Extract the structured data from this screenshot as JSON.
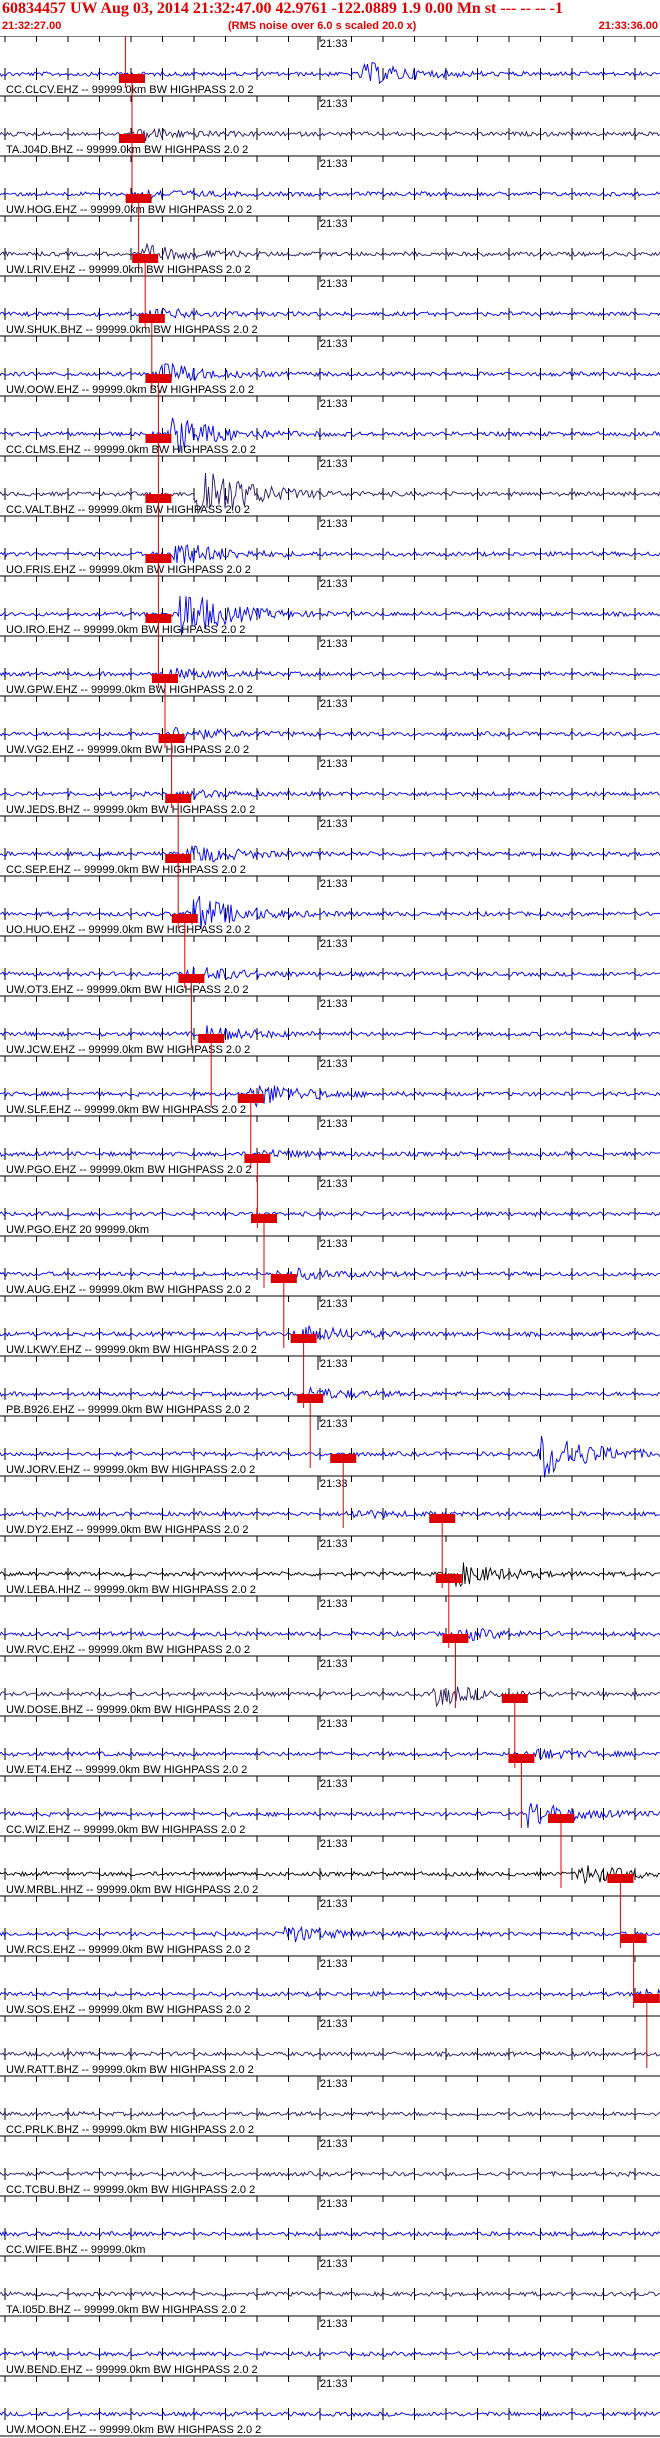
{
  "header": {
    "title": "60834457 UW Aug 03, 2014 21:32:47.00   42.9761 -122.0889  1.9 0.00 Mn st --- -- --  -1",
    "start_time": "21:32:27.00",
    "note": "(RMS noise over 6.0 s scaled 20.0 x)",
    "end_time": "21:33:36.00"
  },
  "minute_mark": "21:33",
  "colors": {
    "blue": "#0000ee",
    "purple": "#2a1a66",
    "black": "#000000",
    "pick": "#dd0000",
    "grid": "#000000"
  },
  "channels": [
    {
      "label": "CC.CLCV.EHZ -- 99999.0km BW  HIGHPASS  2.0  2",
      "color": "blue",
      "pick": 0.19,
      "burst": 0.55,
      "burst_amp": 3.0
    },
    {
      "label": "TA.J04D.BHZ -- 99999.0km BW  HIGHPASS  2.0  2",
      "color": "purple",
      "pick": 0.2,
      "burst": 0.21,
      "burst_amp": 1.6
    },
    {
      "label": "UW.HOG.EHZ -- 99999.0km BW  HIGHPASS  2.0  2",
      "color": "blue",
      "pick": 0.2,
      "burst": 0.21,
      "burst_amp": 1.3
    },
    {
      "label": "UW.LRIV.EHZ -- 99999.0km BW  HIGHPASS  2.0  2",
      "color": "purple",
      "pick": 0.21,
      "burst": 0.22,
      "burst_amp": 2.0
    },
    {
      "label": "UW.SHUK.BHZ -- 99999.0km BW  HIGHPASS  2.0  2",
      "color": "blue",
      "pick": 0.22,
      "burst": 0.23,
      "burst_amp": 1.4
    },
    {
      "label": "UW.OOW.EHZ -- 99999.0km BW  HIGHPASS  2.0  2",
      "color": "blue",
      "pick": 0.23,
      "burst": 0.24,
      "burst_amp": 3.0
    },
    {
      "label": "CC.CLMS.EHZ -- 99999.0km BW  HIGHPASS  2.0  2",
      "color": "blue",
      "pick": 0.24,
      "burst": 0.26,
      "burst_amp": 5.0
    },
    {
      "label": "CC.VALT.BHZ -- 99999.0km BW  HIGHPASS  2.0  2",
      "color": "purple",
      "pick": 0.24,
      "burst": 0.3,
      "burst_amp": 9.0
    },
    {
      "label": "UO.FRIS.EHZ -- 99999.0km BW  HIGHPASS  2.0  2",
      "color": "blue",
      "pick": 0.24,
      "burst": 0.26,
      "burst_amp": 3.5
    },
    {
      "label": "UO.IRO.EHZ -- 99999.0km BW  HIGHPASS  2.0  2",
      "color": "blue",
      "pick": 0.24,
      "burst": 0.27,
      "burst_amp": 7.0
    },
    {
      "label": "UW.GPW.EHZ -- 99999.0km BW  HIGHPASS  2.0  2",
      "color": "blue",
      "pick": 0.24,
      "burst": 0.25,
      "burst_amp": 1.4
    },
    {
      "label": "UW.VG2.EHZ -- 99999.0km BW  HIGHPASS  2.0  2",
      "color": "blue",
      "pick": 0.25,
      "burst": 0.26,
      "burst_amp": 1.8
    },
    {
      "label": "UW.JEDS.BHZ -- 99999.0km BW  HIGHPASS  2.0  2",
      "color": "blue",
      "pick": 0.26,
      "burst": 0.28,
      "burst_amp": 0.8
    },
    {
      "label": "CC.SEP.EHZ -- 99999.0km BW  HIGHPASS  2.0  2",
      "color": "blue",
      "pick": 0.27,
      "burst": 0.29,
      "burst_amp": 2.5
    },
    {
      "label": "UO.HUO.EHZ -- 99999.0km BW  HIGHPASS  2.0  2",
      "color": "blue",
      "pick": 0.27,
      "burst": 0.29,
      "burst_amp": 5.0
    },
    {
      "label": "UW.OT3.EHZ -- 99999.0km BW  HIGHPASS  2.0  2",
      "color": "blue",
      "pick": 0.28,
      "burst": 0.29,
      "burst_amp": 2.2
    },
    {
      "label": "UW.JCW.EHZ -- 99999.0km BW  HIGHPASS  2.0  2",
      "color": "blue",
      "pick": 0.29,
      "burst": 0.31,
      "burst_amp": 2.0
    },
    {
      "label": "UW.SLF.EHZ -- 99999.0km BW  HIGHPASS  2.0  2",
      "color": "blue",
      "pick": 0.32,
      "burst": 0.38,
      "burst_amp": 3.5
    },
    {
      "label": "UW.PGO.EHZ -- 99999.0km BW  HIGHPASS  2.0  2",
      "color": "blue",
      "pick": 0.38,
      "burst": 0.4,
      "burst_amp": 0.9
    },
    {
      "label": "UW.PGO.EHZ 20 99999.0km",
      "color": "blue",
      "pick": 0.39,
      "burst": 0.0,
      "burst_amp": 0.0
    },
    {
      "label": "UW.AUG.EHZ -- 99999.0km BW  HIGHPASS  2.0  2",
      "color": "blue",
      "pick": 0.4,
      "burst": 0.42,
      "burst_amp": 1.8
    },
    {
      "label": "UW.LKWY.EHZ -- 99999.0km BW  HIGHPASS  2.0  2",
      "color": "blue",
      "pick": 0.43,
      "burst": 0.45,
      "burst_amp": 2.4
    },
    {
      "label": "PB.B926.EHZ -- 99999.0km BW  HIGHPASS  2.0  2",
      "color": "blue",
      "pick": 0.46,
      "burst": 0.47,
      "burst_amp": 1.4
    },
    {
      "label": "UW.JORV.EHZ -- 99999.0km BW  HIGHPASS  2.0  2",
      "color": "blue",
      "pick": 0.47,
      "burst": 0.82,
      "burst_amp": 6.5
    },
    {
      "label": "UW.DY2.EHZ -- 99999.0km BW  HIGHPASS  2.0  2",
      "color": "blue",
      "pick": 0.52,
      "burst": 0.53,
      "burst_amp": 1.0
    },
    {
      "label": "UW.LEBA.HHZ -- 99999.0km BW  HIGHPASS  2.0  2",
      "color": "black",
      "pick": 0.67,
      "burst": 0.69,
      "burst_amp": 3.0
    },
    {
      "label": "UW.RVC.EHZ -- 99999.0km BW  HIGHPASS  2.0  2",
      "color": "blue",
      "pick": 0.68,
      "burst": 0.7,
      "burst_amp": 1.4
    },
    {
      "label": "UW.DOSE.BHZ -- 99999.0km BW  HIGHPASS  2.0  2",
      "color": "purple",
      "pick": 0.69,
      "burst": 0.66,
      "burst_amp": 2.8
    },
    {
      "label": "UW.ET4.EHZ -- 99999.0km BW  HIGHPASS  2.0  2",
      "color": "blue",
      "pick": 0.78,
      "burst": 0.8,
      "burst_amp": 1.4
    },
    {
      "label": "CC.WIZ.EHZ -- 99999.0km BW  HIGHPASS  2.0  2",
      "color": "blue",
      "pick": 0.79,
      "burst": 0.8,
      "burst_amp": 3.2
    },
    {
      "label": "UW.MRBL.HHZ -- 99999.0km BW  HIGHPASS  2.0  2",
      "color": "black",
      "pick": 0.85,
      "burst": 0.88,
      "burst_amp": 2.5
    },
    {
      "label": "UW.RCS.EHZ -- 99999.0km BW  HIGHPASS  2.0  2",
      "color": "blue",
      "pick": 0.94,
      "burst": 0.43,
      "burst_amp": 2.2
    },
    {
      "label": "UW.SOS.EHZ -- 99999.0km BW  HIGHPASS  2.0  2",
      "color": "blue",
      "pick": 0.96,
      "burst": 0.97,
      "burst_amp": 1.4
    },
    {
      "label": "UW.RATT.BHZ -- 99999.0km BW  HIGHPASS  2.0  2",
      "color": "purple",
      "pick": 0.98,
      "burst": 0.0,
      "burst_amp": 0.0
    },
    {
      "label": "CC.PRLK.BHZ -- 99999.0km BW  HIGHPASS  2.0  2",
      "color": "purple",
      "pick": null,
      "burst": 0.0,
      "burst_amp": 0.0
    },
    {
      "label": "CC.TCBU.BHZ -- 99999.0km BW  HIGHPASS  2.0  2",
      "color": "purple",
      "pick": null,
      "burst": 0.0,
      "burst_amp": 0.0
    },
    {
      "label": "CC.WIFE.BHZ -- 99999.0km",
      "color": "blue",
      "pick": null,
      "burst": 0.0,
      "burst_amp": 0.0
    },
    {
      "label": "TA.I05D.BHZ -- 99999.0km BW  HIGHPASS  2.0  2",
      "color": "purple",
      "pick": null,
      "burst": 0.0,
      "burst_amp": 0.0
    },
    {
      "label": "UW.BEND.EHZ -- 99999.0km BW  HIGHPASS  2.0  2",
      "color": "blue",
      "pick": null,
      "burst": 0.0,
      "burst_amp": 0.0
    },
    {
      "label": "UW.MOON.EHZ -- 99999.0km BW  HIGHPASS  2.0  2",
      "color": "blue",
      "pick": null,
      "burst": 0.0,
      "burst_amp": 0.0
    }
  ]
}
